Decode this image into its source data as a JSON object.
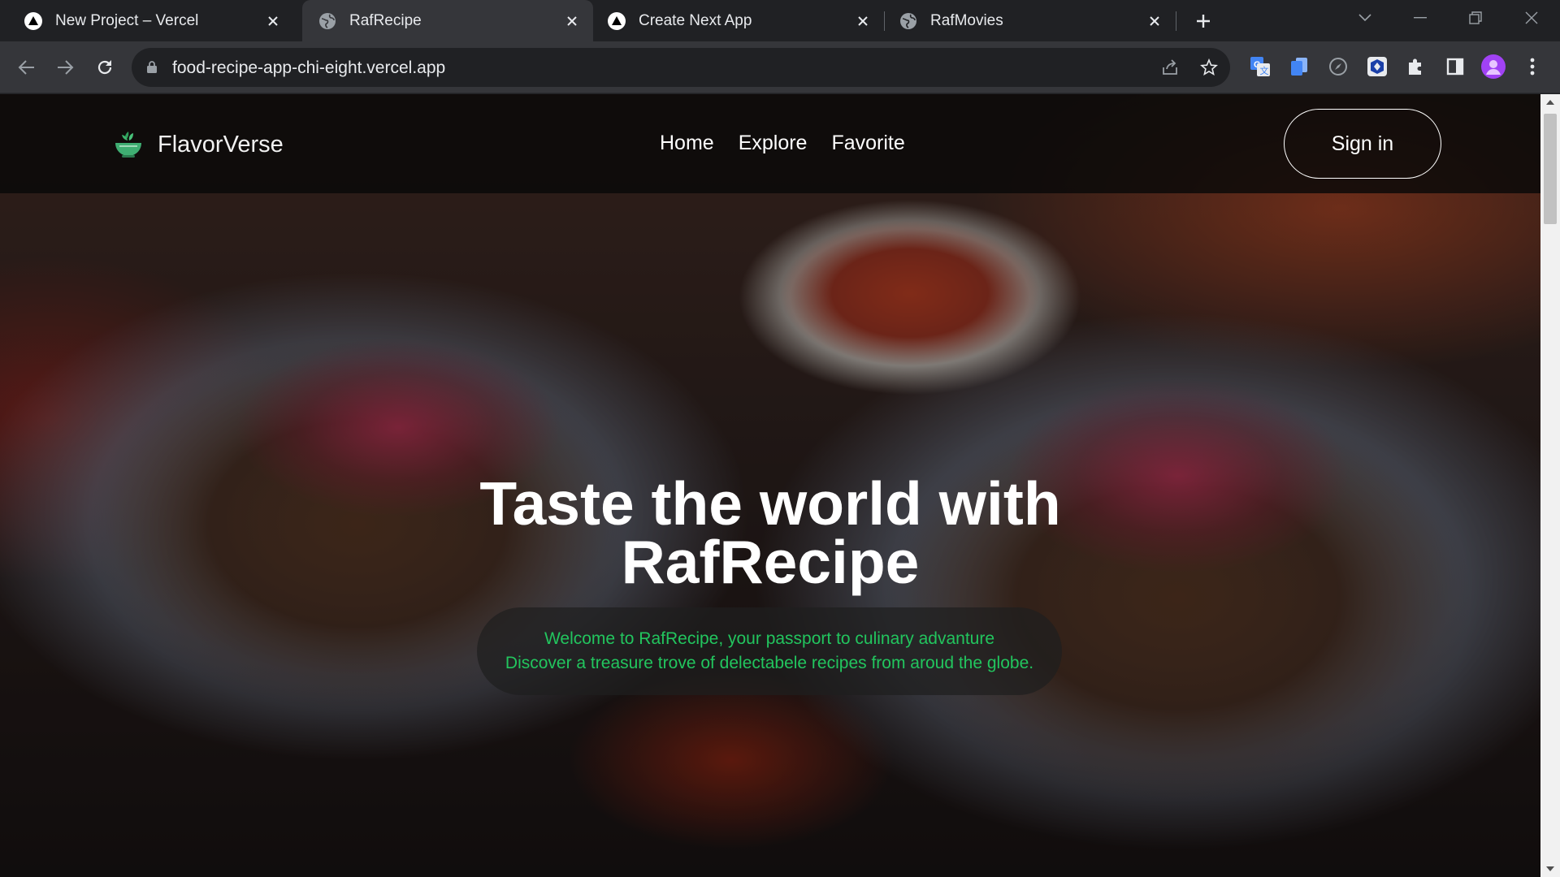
{
  "browser": {
    "tabs": [
      {
        "title": "New Project – Vercel",
        "favicon": "vercel-icon",
        "active": false
      },
      {
        "title": "RafRecipe",
        "favicon": "globe-icon",
        "active": true
      },
      {
        "title": "Create Next App",
        "favicon": "vercel-icon",
        "active": false
      },
      {
        "title": "RafMovies",
        "favicon": "globe-icon",
        "active": false
      }
    ],
    "url": "food-recipe-app-chi-eight.vercel.app",
    "extensions": [
      "google-translate-icon",
      "docs-icon",
      "compass-icon",
      "shield-extension-icon",
      "puzzle-icon",
      "side-panel-icon",
      "profile-avatar",
      "kebab-menu-icon"
    ]
  },
  "site": {
    "brand": "FlavorVerse",
    "nav": {
      "home": "Home",
      "explore": "Explore",
      "favorite": "Favorite"
    },
    "signin": "Sign in"
  },
  "hero": {
    "title_line1": "Taste the world with",
    "title_line2": "RafRecipe",
    "subtitle_line1": "Welcome to RafRecipe, your passport to culinary advanture",
    "subtitle_line2": "Discover a treasure trove of delectabele recipes from aroud the globe."
  },
  "colors": {
    "accent_green": "#22c55e",
    "chrome_dark": "#202124",
    "chrome_toolbar": "#35363a"
  }
}
